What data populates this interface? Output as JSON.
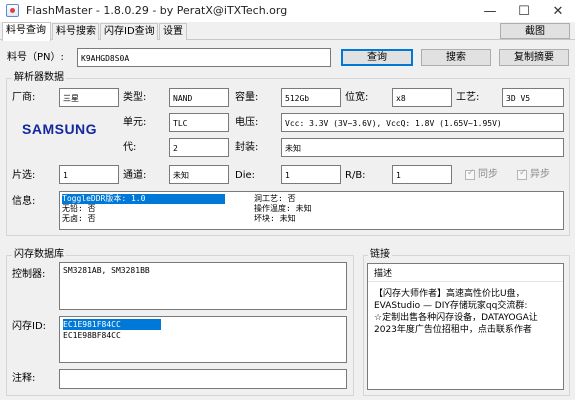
{
  "window": {
    "title": "FlashMaster - 1.8.0.29 - by PeratX@iTXTech.org",
    "minimize": "—",
    "maximize": "☐",
    "close": "✕"
  },
  "tabs": [
    {
      "label": "料号查询"
    },
    {
      "label": "料号搜索"
    },
    {
      "label": "闪存ID查询"
    },
    {
      "label": "设置"
    }
  ],
  "toolbar": {
    "screenshot_label": "截图"
  },
  "search": {
    "pn_label": "料号（PN）:",
    "pn_value": "K9AHGD8S0A",
    "query_label": "查询",
    "search_label": "搜索",
    "copy_label": "复制摘要"
  },
  "decoder": {
    "group_label": "解析器数据",
    "vendor_label": "厂商:",
    "vendor_value": "三星",
    "type_label": "类型:",
    "type_value": "NAND",
    "capacity_label": "容量:",
    "capacity_value": "512Gb",
    "width_label": "位宽:",
    "width_value": "x8",
    "process_label": "工艺:",
    "process_value": "3D V5",
    "logo_text": "SAMSUNG",
    "cell_label": "单元:",
    "cell_value": "TLC",
    "voltage_label": "电压:",
    "voltage_value": "Vcc: 3.3V (3V~3.6V), VccQ: 1.8V (1.65V~1.95V)",
    "gen_label": "代:",
    "gen_value": "2",
    "package_label": "封装:",
    "package_value": "未知",
    "chip_select_label": "片选:",
    "chip_select_value": "1",
    "channel_label": "通道:",
    "channel_value": "未知",
    "die_label": "Die:",
    "die_value": "1",
    "rb_label": "R/B:",
    "rb_value": "1",
    "sync_label": "同步",
    "async_label": "异步",
    "info_label": "信息:",
    "info_lines": [
      "ToggleDDR版本: 1.0",
      "无铅: 否",
      "无卤: 否",
      "洞工艺: 否",
      "操作温度: 未知",
      "坏块: 未知"
    ]
  },
  "flashdb": {
    "group_label": "闪存数据库",
    "controller_label": "控制器:",
    "controller_value": "SM3281AB, SM3281BB",
    "flashid_label": "闪存ID:",
    "flashids": [
      "EC1E981F84CC",
      "EC1E98BF84CC"
    ],
    "notes_label": "注释:"
  },
  "links": {
    "group_label": "链接",
    "header": "描述",
    "items": [
      "【闪存大师作者】高速高性价比U盘，",
      "EVAStudio — DIY存储玩家qq交流群:",
      "☆定制出售各种闪存设备，DATAYOGA让",
      "2023年度广告位招租中，点击联系作者"
    ]
  },
  "colors": {
    "selection": "#0078d7",
    "samsung_blue": "#1428a0"
  },
  "icons": {
    "app": "flashmaster-app-icon"
  }
}
